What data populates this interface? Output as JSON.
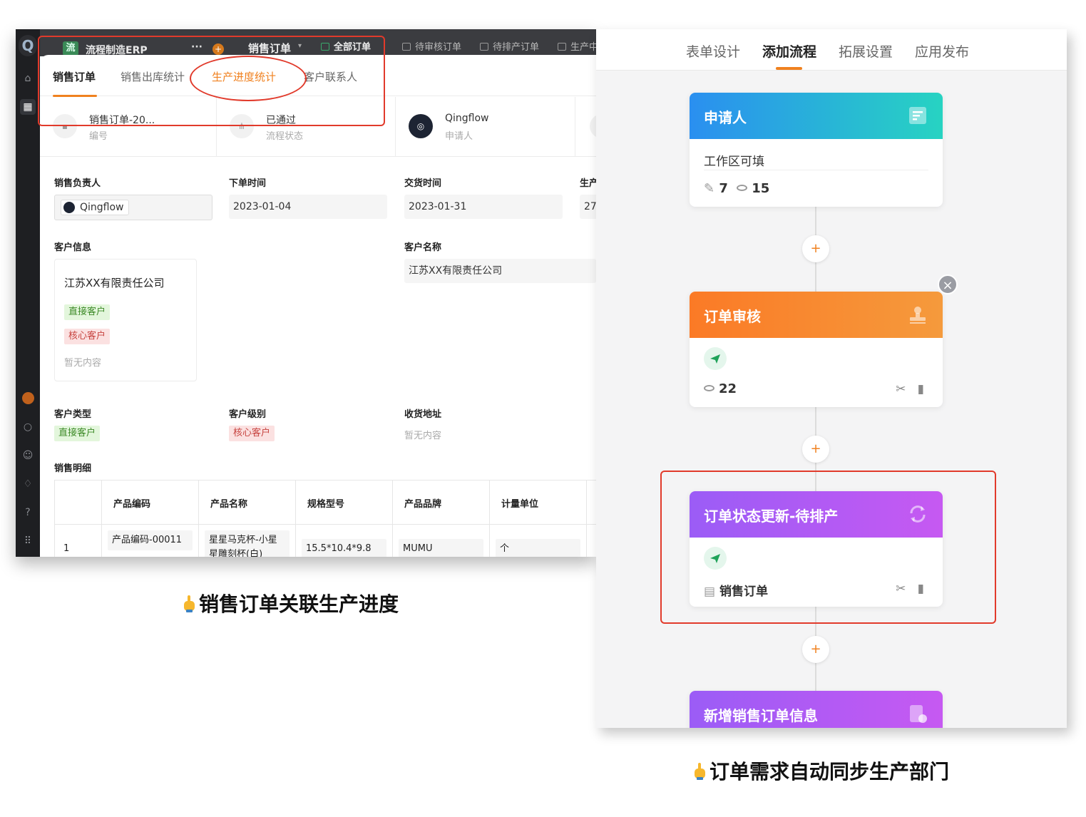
{
  "left": {
    "topbar": {
      "app_badge": "流",
      "app_name": "流程制造ERP",
      "more": "···",
      "title": "销售订单",
      "views": [
        "全部订单",
        "待审核订单",
        "待排产订单",
        "生产中"
      ]
    },
    "tabs": [
      "销售订单",
      "销售出库统计",
      "生产进度统计",
      "客户联系人"
    ],
    "info": [
      {
        "t1": "销售订单-20...",
        "t2": "编号"
      },
      {
        "t1": "已通过",
        "t2": "流程状态"
      },
      {
        "t1": "Qingflow",
        "t2": "申请人"
      }
    ],
    "fields": {
      "sales_owner_label": "销售负责人",
      "sales_owner": "Qingflow",
      "order_time_label": "下单时间",
      "order_time": "2023-01-04",
      "delivery_time_label": "交货时间",
      "delivery_time": "2023-01-31",
      "prod_label": "生产",
      "prod_value": "27",
      "customer_info_label": "客户信息",
      "customer_name_label": "客户名称",
      "customer_name": "江苏XX有限责任公司",
      "card_name": "江苏XX有限责任公司",
      "tag_direct": "直接客户",
      "tag_core": "核心客户",
      "empty": "暂无内容",
      "cust_type_label": "客户类型",
      "cust_type": "直接客户",
      "cust_level_label": "客户级别",
      "cust_level": "核心客户",
      "address_label": "收货地址",
      "address": "暂无内容",
      "detail_label": "销售明细"
    },
    "table": {
      "headers": [
        "产品编码",
        "产品名称",
        "规格型号",
        "产品品牌",
        "计量单位"
      ],
      "row": {
        "index": "1",
        "code": "产品编码-00011",
        "name": "星星马克杯-小星星雕刻杯(白)",
        "spec": "15.5*10.4*9.8",
        "brand": "MUMU",
        "unit": "个"
      }
    },
    "caption": "销售订单关联生产进度"
  },
  "right": {
    "tabs": [
      "表单设计",
      "添加流程",
      "拓展设置",
      "应用发布"
    ],
    "nodes": [
      {
        "title": "申请人",
        "row": "工作区可填",
        "edit_count": "7",
        "view_count": "15"
      },
      {
        "title": "订单审核",
        "view_count": "22"
      },
      {
        "title": "订单状态更新-待排产",
        "form": "销售订单"
      },
      {
        "title": "新增销售订单信息"
      }
    ],
    "caption": "订单需求自动同步生产部门"
  },
  "colors": {
    "accent": "#f0811f",
    "annotation": "#e13a2b",
    "applicant_gradient": [
      "#2a8ff0",
      "#27d3c2"
    ],
    "review_gradient": [
      "#fb7a26",
      "#f59a3c"
    ],
    "update_gradient": [
      "#9b5cf6",
      "#c659f2"
    ]
  }
}
